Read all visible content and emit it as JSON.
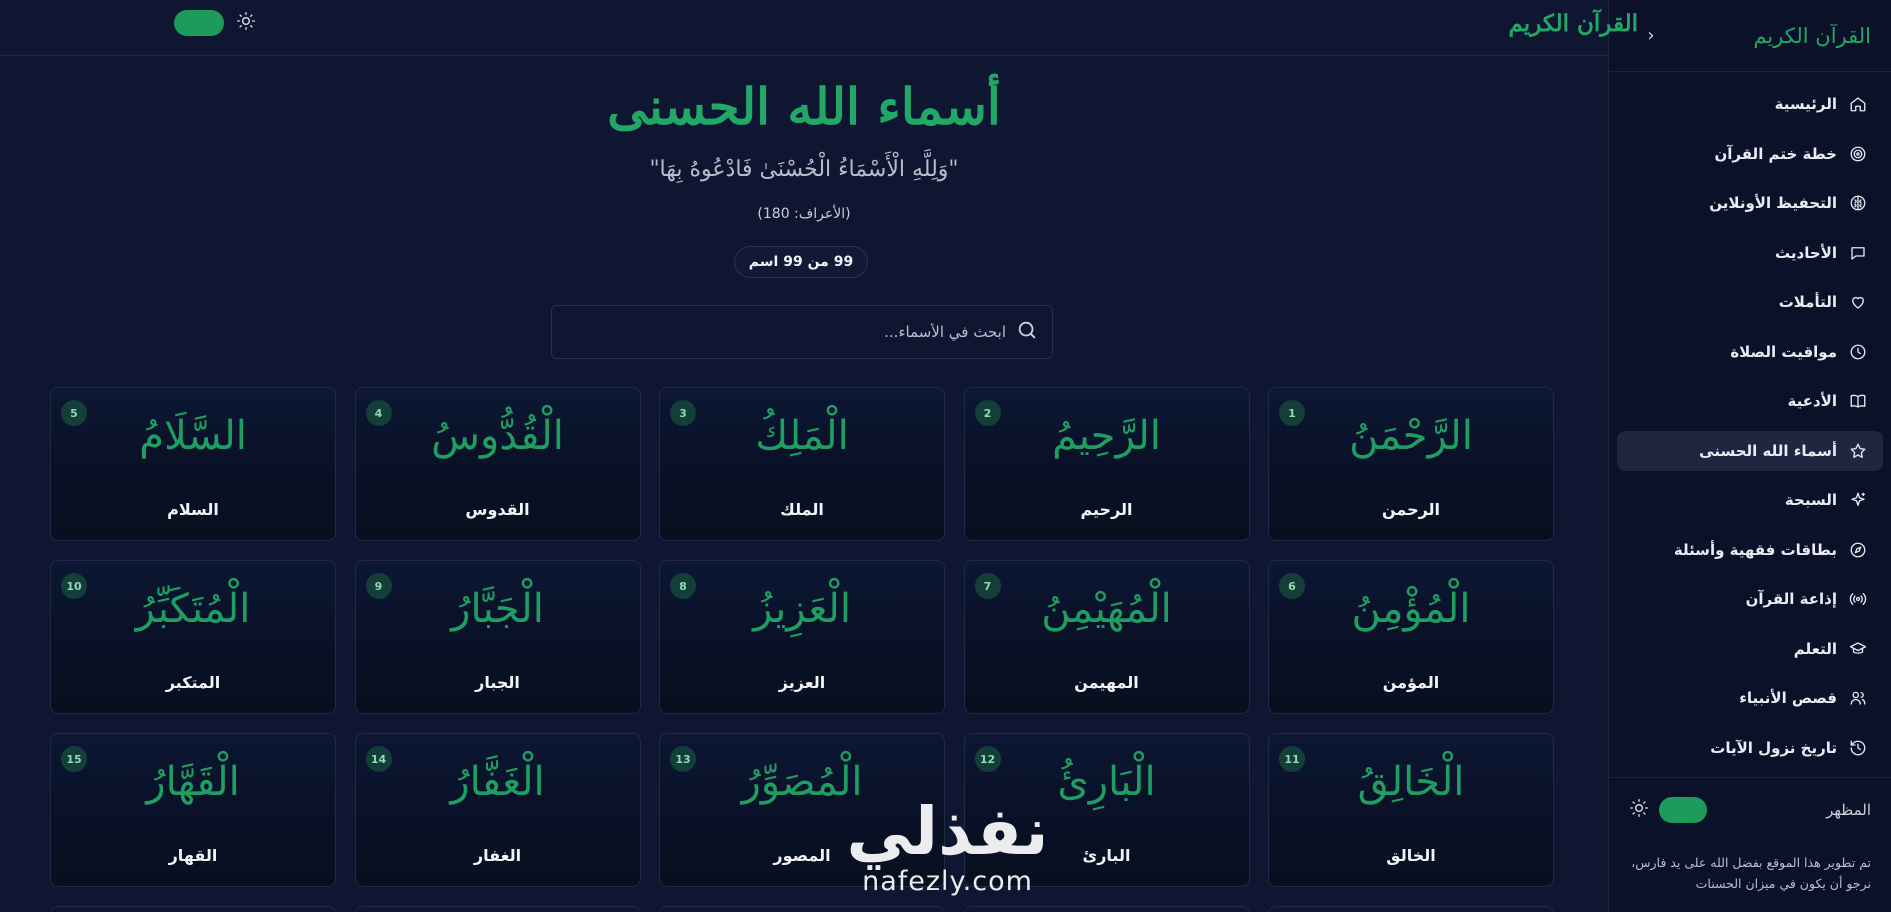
{
  "sidebar": {
    "title": "القرآن الكريم",
    "collapse_icon": "chevron-left-icon",
    "items": [
      {
        "label": "الرئيسية",
        "icon": "home-icon"
      },
      {
        "label": "خطة ختم القرآن",
        "icon": "target-icon"
      },
      {
        "label": "التحفيظ الأونلاين",
        "icon": "brain-icon"
      },
      {
        "label": "الأحاديث",
        "icon": "message-icon"
      },
      {
        "label": "التأملات",
        "icon": "heart-icon"
      },
      {
        "label": "مواقيت الصلاة",
        "icon": "clock-icon"
      },
      {
        "label": "الأدعية",
        "icon": "book-icon"
      },
      {
        "label": "أسماء الله الحسنى",
        "icon": "star-icon",
        "active": true
      },
      {
        "label": "السبحة",
        "icon": "sparkle-icon"
      },
      {
        "label": "بطاقات فقهية وأسئلة",
        "icon": "compass-icon"
      },
      {
        "label": "إذاعة القرآن",
        "icon": "radio-icon"
      },
      {
        "label": "التعلم",
        "icon": "graduation-cap-icon"
      },
      {
        "label": "قصص الأنبياء",
        "icon": "users-icon"
      },
      {
        "label": "تاريخ نزول الآيات",
        "icon": "history-icon"
      }
    ],
    "appearance_label": "المظهر",
    "credits_line1": "تم تطوير هذا الموقع بفضل الله على يد فارس،",
    "credits_line2": "نرجو أن يكون في ميزان الحسنات"
  },
  "topbar": {
    "title": "القرآن الكريم",
    "theme_icon": "sun-icon"
  },
  "main": {
    "title": "أسماء الله الحسنى",
    "verse": "\"وَلِلَّهِ الْأَسْمَاءُ الْحُسْنَىٰ فَادْعُوهُ بِهَا\"",
    "verse_ref": "(الأعراف: 180)",
    "count": "99 من 99 اسم",
    "search_placeholder": "ابحث في الأسماء...",
    "search_value": "",
    "names": [
      {
        "num": "1",
        "arabic": "الرَّحْمَنُ",
        "plain": "الرحمن"
      },
      {
        "num": "2",
        "arabic": "الرَّحِيمُ",
        "plain": "الرحيم"
      },
      {
        "num": "3",
        "arabic": "الْمَلِكُ",
        "plain": "الملك"
      },
      {
        "num": "4",
        "arabic": "الْقُدُّوسُ",
        "plain": "القدوس"
      },
      {
        "num": "5",
        "arabic": "السَّلَامُ",
        "plain": "السلام"
      },
      {
        "num": "6",
        "arabic": "الْمُؤْمِنُ",
        "plain": "المؤمن"
      },
      {
        "num": "7",
        "arabic": "الْمُهَيْمِنُ",
        "plain": "المهيمن"
      },
      {
        "num": "8",
        "arabic": "الْعَزِيزُ",
        "plain": "العزيز"
      },
      {
        "num": "9",
        "arabic": "الْجَبَّارُ",
        "plain": "الجبار"
      },
      {
        "num": "10",
        "arabic": "الْمُتَكَبِّرُ",
        "plain": "المتكبر"
      },
      {
        "num": "11",
        "arabic": "الْخَالِقُ",
        "plain": "الخالق"
      },
      {
        "num": "12",
        "arabic": "الْبَارِئُ",
        "plain": "البارئ"
      },
      {
        "num": "13",
        "arabic": "الْمُصَوِّرُ",
        "plain": "المصور"
      },
      {
        "num": "14",
        "arabic": "الْغَفَّارُ",
        "plain": "الغفار"
      },
      {
        "num": "15",
        "arabic": "الْقَهَّارُ",
        "plain": "القهار"
      }
    ]
  },
  "watermark": {
    "arabic": "نفذلي",
    "latin": "nafezly.com"
  },
  "colors": {
    "background": "#0f1632",
    "sidebar": "#0b1128",
    "accent": "#22a866",
    "toggle": "#1e9a5a"
  }
}
